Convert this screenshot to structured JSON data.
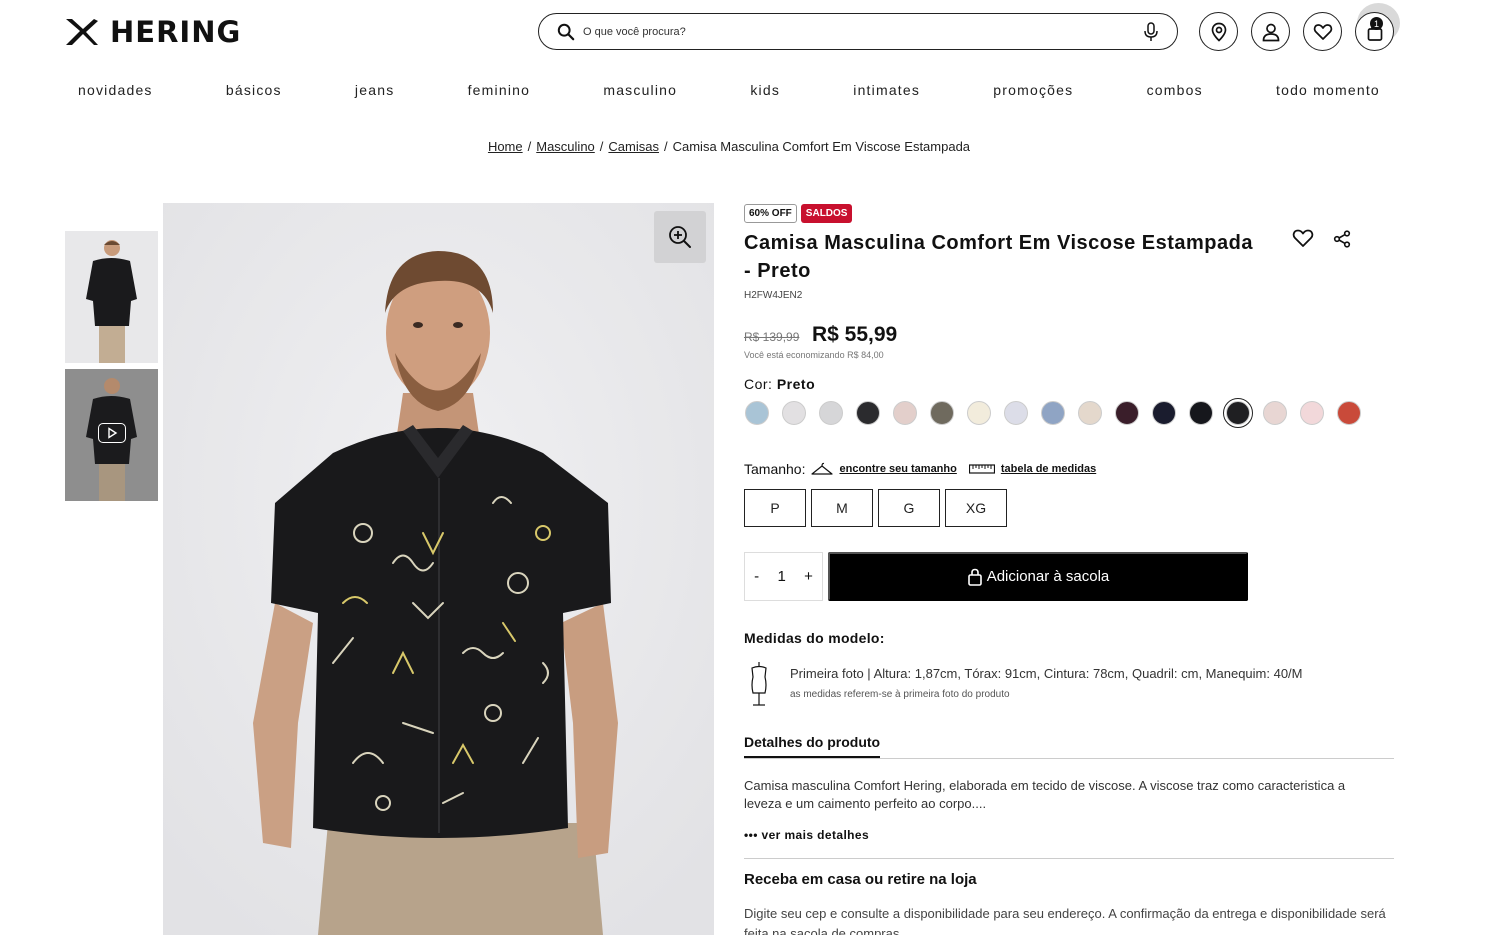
{
  "header": {
    "brand": "HERING",
    "search_placeholder": "O que você procura?",
    "cart_count": "1"
  },
  "nav": [
    "novidades",
    "básicos",
    "jeans",
    "feminino",
    "masculino",
    "kids",
    "intimates",
    "promoções",
    "combos",
    "todo momento"
  ],
  "breadcrumb": {
    "items": [
      "Home",
      "Masculino",
      "Camisas"
    ],
    "current": "Camisa Masculina Comfort Em Viscose Estampada"
  },
  "product": {
    "discount_badge": "60% OFF",
    "sale_badge": "SALDOS",
    "title": "Camisa Masculina Comfort Em Viscose Estampada - Preto",
    "sku": "H2FW4JEN2",
    "old_price": "R$ 139,99",
    "price": "R$ 55,99",
    "savings": "Você está economizando R$ 84,00",
    "color_label": "Cor:",
    "color_value": "Preto",
    "swatches": [
      "#a9c4d6",
      "#e2e0e2",
      "#d6d6d8",
      "#2b2b2e",
      "#e3cfcb",
      "#6f6a5e",
      "#f2ecdc",
      "#dcdde8",
      "#8fa4c4",
      "#e4d8cc",
      "#3a1e2a",
      "#1a1c2e",
      "#16171c",
      "#1f1f22",
      "#e8d6d3",
      "#f2d8da",
      "#c94a3a"
    ],
    "size_label": "Tamanho:",
    "find_size": "encontre seu tamanho",
    "size_table": "tabela de medidas",
    "sizes": [
      "P",
      "M",
      "G",
      "XG"
    ],
    "qty_minus": "-",
    "qty": "1",
    "qty_plus": "+",
    "add_to_bag": "Adicionar à sacola",
    "model_heading": "Medidas do modelo:",
    "model_text": "Primeira foto | Altura: 1,87cm, Tórax: 91cm, Cintura: 78cm, Quadril: cm, Manequim: 40/M",
    "model_note": "as medidas referem-se à primeira foto do produto",
    "details_tab": "Detalhes do produto",
    "description": "Camisa masculina Comfort Hering, elaborada em tecido de viscose. A viscose traz como caracteristica a leveza e um caimento perfeito ao corpo....",
    "more_details": "••• ver mais detalhes",
    "shipping_heading": "Receba em casa ou retire na loja",
    "shipping_text": "Digite seu cep e consulte a disponibilidade para seu endereço. A confirmação da entrega e disponibilidade será feita na sacola de compras."
  }
}
